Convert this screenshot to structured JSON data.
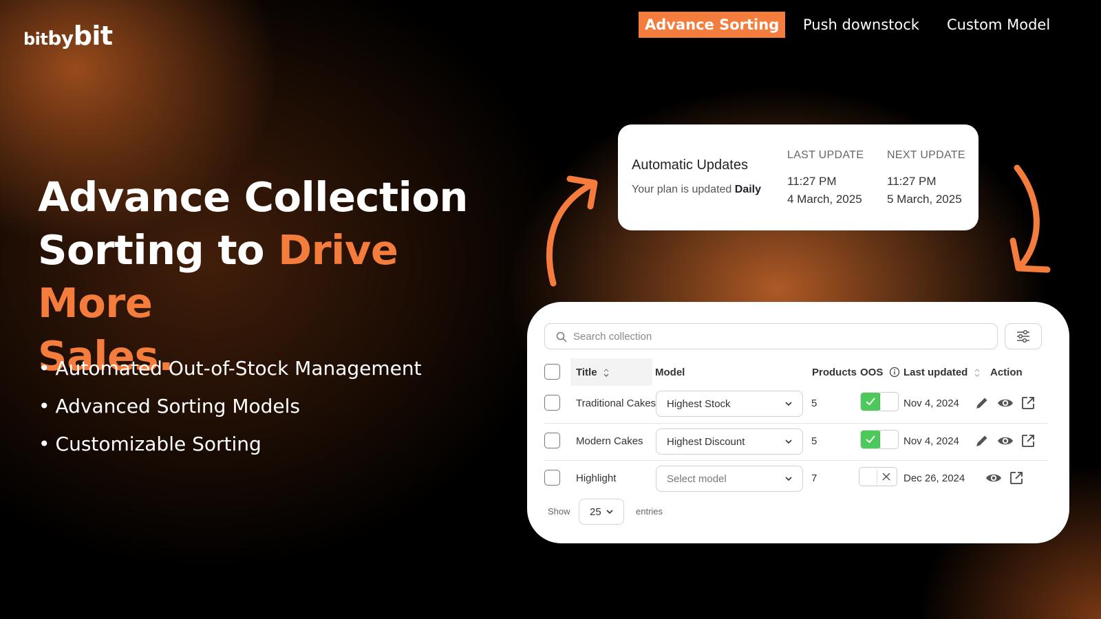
{
  "brand": {
    "logo_part1": "bit",
    "logo_part2": "by",
    "logo_part3": "bit"
  },
  "nav": {
    "items": [
      {
        "label": "Advance Sorting",
        "active": true
      },
      {
        "label": "Push downstock",
        "active": false
      },
      {
        "label": "Custom Model",
        "active": false
      }
    ]
  },
  "hero": {
    "line1": "Advance Collection",
    "line2_plain": "Sorting to ",
    "line2_accent": "Drive More",
    "line3_accent": "Sales.",
    "bullets": [
      "Automated Out-of-Stock Management",
      "Advanced Sorting Models",
      "Customizable Sorting"
    ]
  },
  "auto_updates": {
    "title": "Automatic Updates",
    "subtitle_prefix": "Your plan is updated",
    "frequency": "Daily",
    "last_update_label": "LAST UPDATE",
    "last_update_time": "11:27 PM",
    "last_update_date": "4 March, 2025",
    "next_update_label": "NEXT UPDATE",
    "next_update_time": "11:27 PM",
    "next_update_date": "5 March, 2025"
  },
  "table": {
    "search_placeholder": "Search collection",
    "columns": {
      "title": "Title",
      "model": "Model",
      "products": "Products",
      "oos": "OOS",
      "last_updated": "Last updated",
      "action": "Action"
    },
    "rows": [
      {
        "title": "Traditional Cakes",
        "model": "Highest Stock",
        "products": "5",
        "oos": true,
        "last_updated": "Nov 4, 2024"
      },
      {
        "title": "Modern Cakes",
        "model": "Highest Discount",
        "products": "5",
        "oos": true,
        "last_updated": "Nov 4, 2024"
      },
      {
        "title": "Highlight",
        "model": "Select model",
        "products": "7",
        "oos": false,
        "last_updated": "Dec 26, 2024"
      }
    ],
    "footer": {
      "show_label": "Show",
      "page_size": "25",
      "entries_label": "entries"
    }
  },
  "colors": {
    "accent": "#f47c3c",
    "toggle_on": "#4cc95a",
    "background": "#000000"
  }
}
